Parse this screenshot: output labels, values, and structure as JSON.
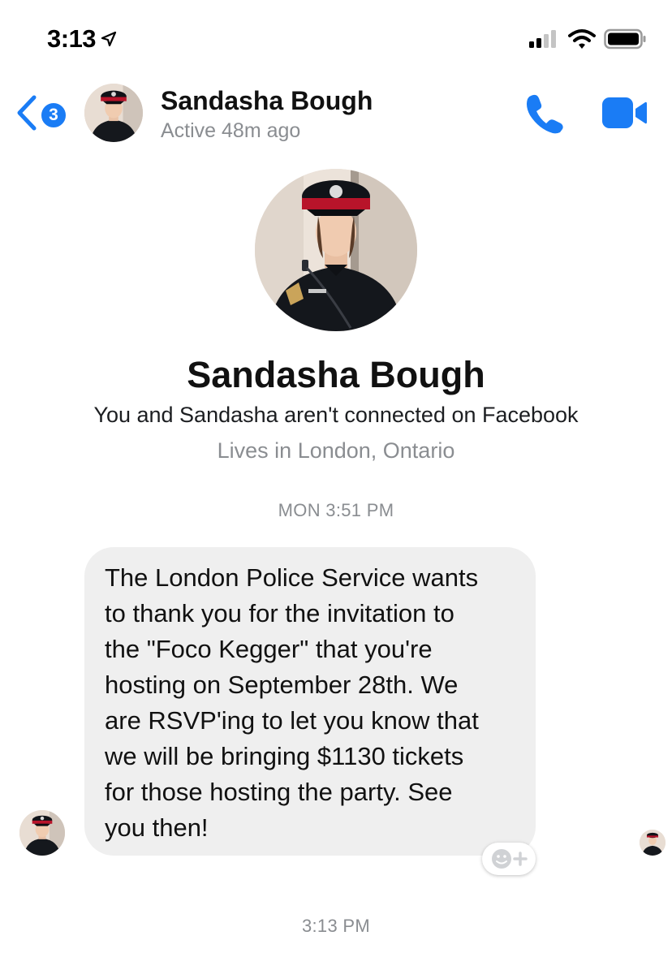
{
  "status_bar": {
    "time": "3:13",
    "icons": [
      "location-arrow-icon",
      "cellular-signal-icon",
      "wifi-icon",
      "battery-icon"
    ]
  },
  "header": {
    "back_badge_count": "3",
    "contact_name": "Sandasha Bough",
    "active_status": "Active 48m ago",
    "actions": [
      "phone-call-icon",
      "video-call-icon"
    ],
    "accent_color": "#1a7cf5"
  },
  "profile": {
    "name": "Sandasha Bough",
    "connection_note": "You and Sandasha aren't connected on Facebook",
    "location": "Lives in London, Ontario"
  },
  "conversation": {
    "timestamp_1": "MON 3:51 PM",
    "message_lines": [
      "The London Police Service wants",
      "to thank you for the invitation to",
      "the \"Foco Kegger\" that you're",
      "hosting on September 28th. We",
      "are RSVP'ing to let you know that",
      "we will be bringing $1130 tickets",
      "for those hosting the party. See",
      "you then!"
    ],
    "timestamp_2": "3:13 PM",
    "bubble_color": "#efefef"
  }
}
